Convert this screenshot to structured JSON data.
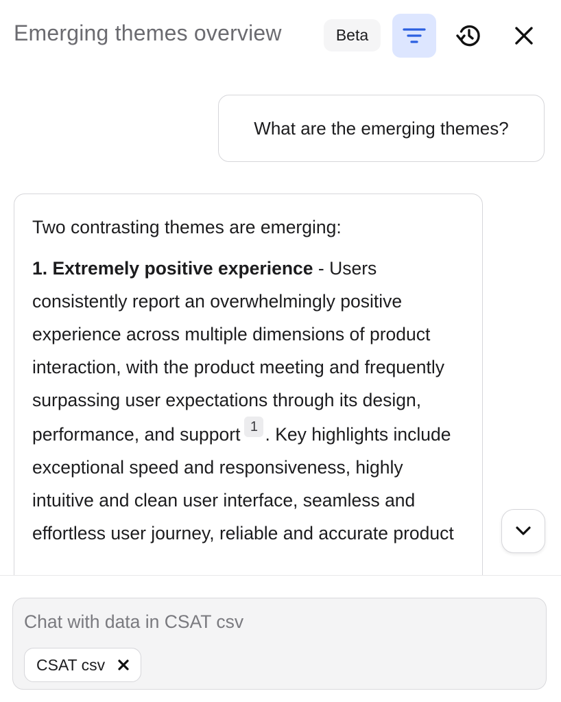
{
  "header": {
    "title": "Emerging themes overview",
    "badge": "Beta",
    "icons": {
      "filter": "filter-icon",
      "history": "history-icon",
      "close": "close-icon"
    },
    "colors": {
      "filter_active_bg": "#dde6ff",
      "filter_icon": "#2b5fe0"
    }
  },
  "conversation": {
    "user_message": "What are the emerging themes?",
    "assistant_message": {
      "intro": "Two contrasting themes are emerging:",
      "theme_heading": "1. Extremely positive experience",
      "theme_separator": " - ",
      "theme_text_before_citation": "Users consistently report an overwhelmingly positive experience across multiple dimensions of product interaction, with the product meeting and frequently surpassing user expectations through its design, performance, and support",
      "citation": "1",
      "theme_text_after_citation": ". Key highlights include exceptional speed and responsiveness, highly intuitive and clean user interface, seamless and effortless user journey, reliable and accurate product"
    }
  },
  "scroll_button_icon": "chevron-down-icon",
  "composer": {
    "placeholder": "Chat with data in CSAT csv",
    "value": "",
    "attachment": {
      "label": "CSAT csv",
      "remove_icon": "x-icon"
    }
  }
}
